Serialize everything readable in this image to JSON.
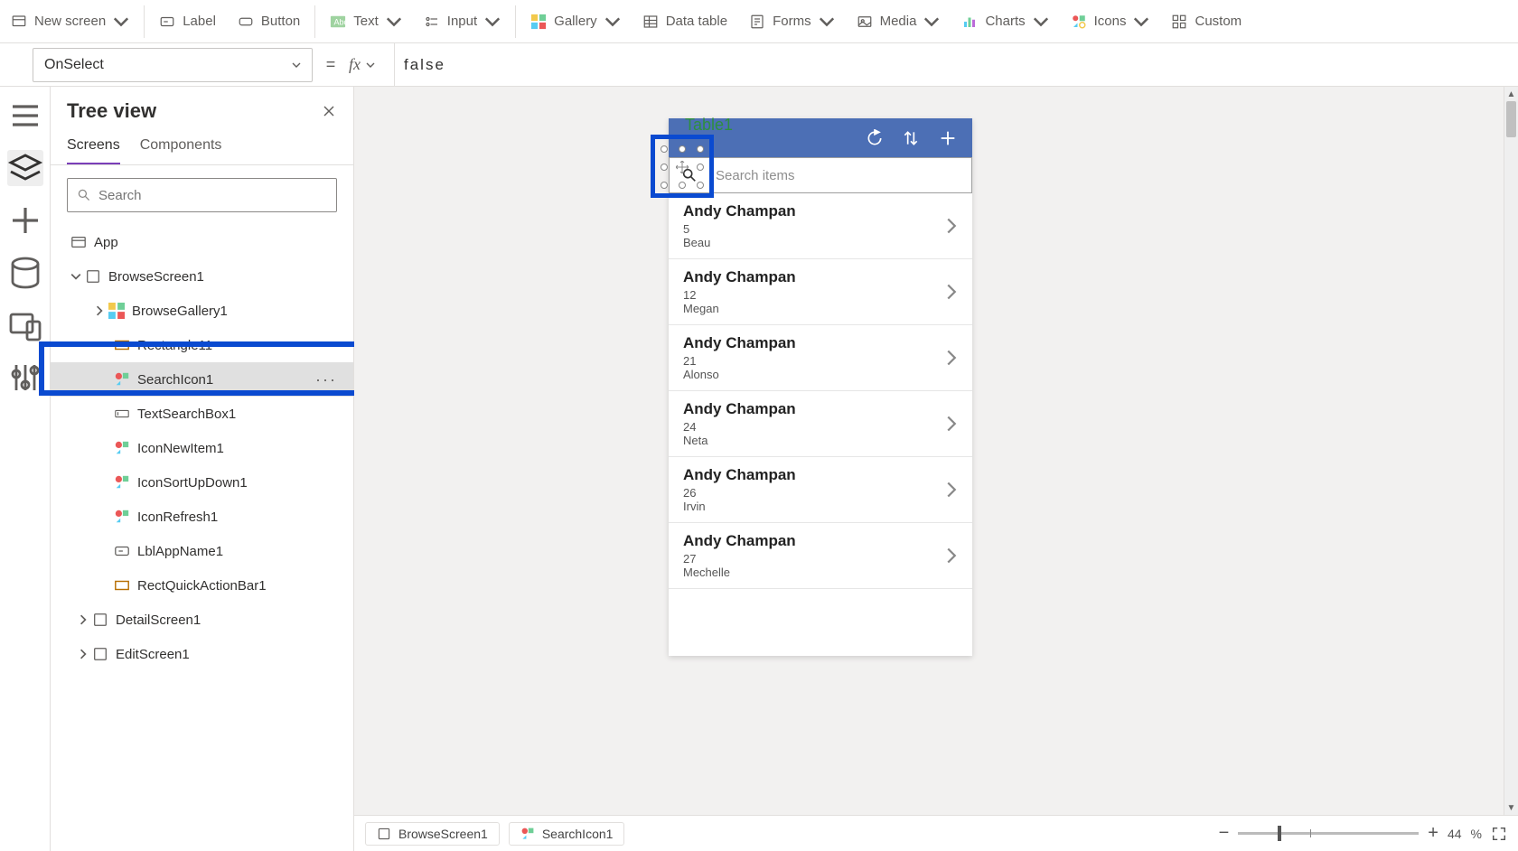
{
  "ribbon": {
    "newScreen": "New screen",
    "label": "Label",
    "button": "Button",
    "text": "Text",
    "input": "Input",
    "gallery": "Gallery",
    "dataTable": "Data table",
    "forms": "Forms",
    "media": "Media",
    "charts": "Charts",
    "icons": "Icons",
    "custom": "Custom"
  },
  "formula": {
    "property": "OnSelect",
    "value": "false"
  },
  "tree": {
    "title": "Tree view",
    "tabs": {
      "screens": "Screens",
      "components": "Components"
    },
    "searchPlaceholder": "Search",
    "app": "App",
    "browseScreen": "BrowseScreen1",
    "browseGallery": "BrowseGallery1",
    "rectangle11": "Rectangle11",
    "searchIcon1": "SearchIcon1",
    "textSearchBox1": "TextSearchBox1",
    "iconNewItem1": "IconNewItem1",
    "iconSortUpDown1": "IconSortUpDown1",
    "iconRefresh1": "IconRefresh1",
    "lblAppName1": "LblAppName1",
    "rectQuickActionBar1": "RectQuickActionBar1",
    "detailScreen": "DetailScreen1",
    "editScreen": "EditScreen1"
  },
  "canvas": {
    "titleGhost": "Table1",
    "searchPlaceholder": "Search items",
    "items": [
      {
        "name": "Andy Champan",
        "num": "5",
        "who": "Beau"
      },
      {
        "name": "Andy Champan",
        "num": "12",
        "who": "Megan"
      },
      {
        "name": "Andy Champan",
        "num": "21",
        "who": "Alonso"
      },
      {
        "name": "Andy Champan",
        "num": "24",
        "who": "Neta"
      },
      {
        "name": "Andy Champan",
        "num": "26",
        "who": "Irvin"
      },
      {
        "name": "Andy Champan",
        "num": "27",
        "who": "Mechelle"
      }
    ]
  },
  "breadcrumb": {
    "screen": "BrowseScreen1",
    "control": "SearchIcon1"
  },
  "zoom": {
    "label": "44",
    "pct": "%"
  }
}
